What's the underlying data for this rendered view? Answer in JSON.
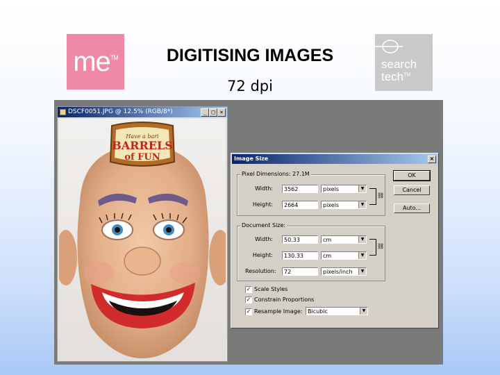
{
  "header": {
    "title": "DIGITISING IMAGES",
    "subtitle": "72 dpi",
    "logo_left_text": "me",
    "logo_left_tm": "TM",
    "logo_right_line1": "search",
    "logo_right_line2": "tech",
    "logo_right_tm": "TM"
  },
  "colors": {
    "logo_left_bg": "#ee8aa6",
    "logo_right_bg": "#c9c9c9",
    "titlebar_active": "#0a246a"
  },
  "doc_window": {
    "title": "DSCF0051.JPG @ 12.5% (RGB/8*)",
    "sign_line1": "Have a bari",
    "sign_line2": "BARRELS",
    "sign_line3": "of FUN",
    "btn_min": "_",
    "btn_max": "□",
    "btn_close": "×"
  },
  "dialog": {
    "title": "Image Size",
    "close": "×",
    "pixel_dimensions": {
      "legend": "Pixel Dimensions: 27.1M",
      "width_label": "Width:",
      "width_value": "3562",
      "width_unit": "pixels",
      "height_label": "Height:",
      "height_value": "2664",
      "height_unit": "pixels"
    },
    "document_size": {
      "legend": "Document Size:",
      "width_label": "Width:",
      "width_value": "50.33",
      "width_unit": "cm",
      "height_label": "Height:",
      "height_value": "130.33",
      "height_unit": "cm",
      "resolution_label": "Resolution:",
      "resolution_value": "72",
      "resolution_unit": "pixels/inch"
    },
    "checkboxes": [
      {
        "label": "Scale Styles",
        "checked": true
      },
      {
        "label": "Constrain Proportions",
        "checked": true
      },
      {
        "label": "Resample Image:",
        "checked": true
      }
    ],
    "resample_method": "Bicubic",
    "buttons": {
      "ok": "OK",
      "cancel": "Cancel",
      "auto": "Auto..."
    }
  }
}
